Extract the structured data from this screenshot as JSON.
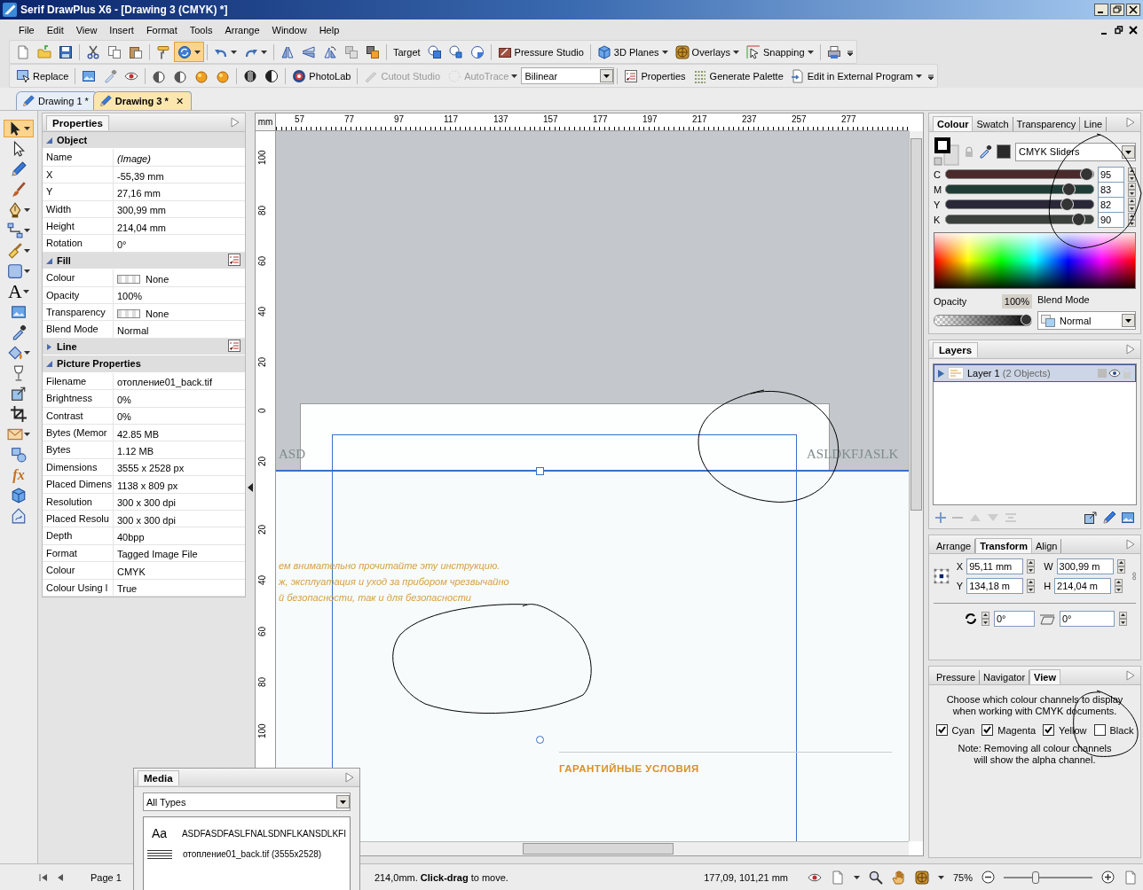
{
  "window": {
    "title": "Serif DrawPlus X6 - [Drawing 3 (CMYK) *]"
  },
  "menu": [
    "File",
    "Edit",
    "View",
    "Insert",
    "Format",
    "Tools",
    "Arrange",
    "Window",
    "Help"
  ],
  "toolbar_1": [
    [
      {
        "kind": "icon"
      },
      {
        "kind": "icon"
      },
      {
        "kind": "icon"
      }
    ],
    [
      {
        "kind": "icon"
      },
      {
        "kind": "icon"
      },
      {
        "kind": "icon"
      }
    ],
    [
      {
        "kind": "icon"
      },
      {
        "kind": "icon",
        "selected": true,
        "menu": true
      }
    ],
    [
      {
        "kind": "icon",
        "menu": true
      },
      {
        "kind": "icon",
        "menu": true
      }
    ],
    [
      {
        "kind": "icon"
      },
      {
        "kind": "icon"
      },
      {
        "kind": "icon"
      },
      {
        "kind": "icon"
      },
      {
        "kind": "icon"
      }
    ],
    [
      {
        "kind": "text",
        "label": "Target"
      },
      {
        "kind": "icon"
      },
      {
        "kind": "icon"
      },
      {
        "kind": "icon"
      }
    ],
    [
      {
        "kind": "button",
        "label": "Pressure Studio"
      }
    ],
    [
      {
        "kind": "button",
        "label": "3D Planes",
        "menu": true
      },
      {
        "kind": "button",
        "label": "Overlays",
        "menu": true
      },
      {
        "kind": "button",
        "label": "Snapping",
        "menu": true
      }
    ],
    [
      {
        "kind": "icon"
      }
    ]
  ],
  "toolbar_2": [
    [
      {
        "kind": "button",
        "label": "Replace"
      }
    ],
    [
      {
        "kind": "icon"
      },
      {
        "kind": "icon",
        "disabled": true
      },
      {
        "kind": "icon"
      }
    ],
    [
      {
        "kind": "icon"
      },
      {
        "kind": "icon"
      },
      {
        "kind": "icon"
      },
      {
        "kind": "icon"
      }
    ],
    [
      {
        "kind": "icon"
      },
      {
        "kind": "icon"
      }
    ],
    [
      {
        "kind": "button",
        "label": "PhotoLab"
      }
    ],
    [
      {
        "kind": "button",
        "label": "Cutout Studio",
        "disabled": true
      },
      {
        "kind": "button",
        "label": "AutoTrace",
        "disabled": true,
        "menu": true
      },
      {
        "kind": "dropdown",
        "value": "Bilinear"
      }
    ],
    [
      {
        "kind": "button",
        "label": "Properties"
      },
      {
        "kind": "button",
        "label": "Generate Palette"
      },
      {
        "kind": "button",
        "label": "Edit in External Program",
        "menu": true
      }
    ]
  ],
  "doc_tabs": [
    {
      "label": "Drawing 1 *",
      "selected": false
    },
    {
      "label": "Drawing 3 *",
      "selected": true,
      "close": "✕"
    }
  ],
  "toolbox": [
    {
      "selected": true,
      "menu": true
    },
    {
      "selected": false
    },
    {
      "selected": false
    },
    {
      "selected": false
    },
    {
      "selected": false,
      "menu": true
    },
    {
      "selected": false,
      "menu": true
    },
    {
      "selected": false,
      "menu": true
    },
    {
      "selected": false,
      "menu": true
    },
    {
      "glyph": "A",
      "selected": false,
      "menu": true
    },
    {
      "selected": false
    },
    {
      "selected": false
    },
    {
      "selected": false,
      "menu": true
    },
    {
      "selected": false
    },
    {
      "selected": false
    },
    {
      "selected": false
    },
    {
      "selected": false,
      "menu": true
    },
    {
      "selected": false
    },
    {
      "glyph": "fx",
      "selected": false
    },
    {
      "selected": false
    },
    {
      "selected": false
    }
  ],
  "properties": {
    "tab": "Properties",
    "sections": [
      {
        "title": "Object",
        "expanded": true,
        "rows": [
          {
            "label": "Name",
            "value": "(Image)",
            "kind": "italic"
          },
          {
            "label": "X",
            "value": "-55,39 mm"
          },
          {
            "label": "Y",
            "value": "27,16 mm"
          },
          {
            "label": "Width",
            "value": "300,99 mm"
          },
          {
            "label": "Height",
            "value": "214,04 mm"
          },
          {
            "label": "Rotation",
            "value": "0°"
          }
        ]
      },
      {
        "title": "Fill",
        "expanded": true,
        "options": true,
        "rows": [
          {
            "label": "Colour",
            "value": "None",
            "kind": "swatch"
          },
          {
            "label": "Opacity",
            "value": "100%"
          },
          {
            "label": "Transparency",
            "value": "None",
            "kind": "swatch"
          },
          {
            "label": "Blend Mode",
            "value": "Normal"
          }
        ]
      },
      {
        "title": "Line",
        "expanded": false,
        "options": true
      },
      {
        "title": "Picture Properties",
        "expanded": true,
        "rows": [
          {
            "label": "Filename",
            "value": "отопление01_back.tif"
          },
          {
            "label": "Brightness",
            "value": "0%"
          },
          {
            "label": "Contrast",
            "value": "0%"
          },
          {
            "label": "Bytes (Memor",
            "value": "42.85 MB"
          },
          {
            "label": "Bytes",
            "value": "1.12 MB"
          },
          {
            "label": "Dimensions",
            "value": "3555 x 2528 px"
          },
          {
            "label": "Placed Dimens",
            "value": "1138 x 809 px"
          },
          {
            "label": "Resolution",
            "value": "300 x 300 dpi"
          },
          {
            "label": "Placed Resolu",
            "value": "300 x 300 dpi"
          },
          {
            "label": "Depth",
            "value": "40bpp"
          },
          {
            "label": "Format",
            "value": "Tagged Image File"
          },
          {
            "label": "Colour",
            "value": "CMYK"
          },
          {
            "label": "Colour Using l",
            "value": "True"
          }
        ]
      }
    ]
  },
  "canvas": {
    "ruler_unit": "mm",
    "top_ruler": [
      "57",
      "77",
      "97",
      "117",
      "137",
      "157",
      "177",
      "197",
      "217",
      "237",
      "257",
      "277"
    ],
    "left_ruler": [
      "100",
      "80",
      "60",
      "40",
      "20",
      "0",
      "20",
      "20",
      "40",
      "60",
      "80",
      "100"
    ],
    "image_text_left": "ASD",
    "image_text_right": "ASLDKFJASLK",
    "body_lines": [
      "ем внимательно прочитайте эту инструкцию.",
      "ж, эксплуатация и уход за прибором чрезвычайно",
      "й безопасности, так и для безопасности"
    ],
    "heading": "ГАРАНТИЙНЫЕ УСЛОВИЯ"
  },
  "colour_panel": {
    "tabs": [
      {
        "label": "Colour",
        "selected": true
      },
      {
        "label": "Swatch",
        "selected": false
      },
      {
        "label": "Transparency",
        "selected": false
      },
      {
        "label": "Line",
        "selected": false
      }
    ],
    "mode": "CMYK Sliders",
    "channels": [
      {
        "name": "C",
        "level": 0.95,
        "value": "95",
        "color": "#4a2a2a"
      },
      {
        "name": "M",
        "level": 0.83,
        "value": "83",
        "color": "#1f3d36"
      },
      {
        "name": "Y",
        "level": 0.82,
        "value": "82",
        "color": "#2a2838"
      },
      {
        "name": "K",
        "level": 0.9,
        "value": "90",
        "color": "#3a403c"
      }
    ],
    "opacity_label": "Opacity",
    "opacity_value": "100%",
    "opacity": {
      "level": 1
    },
    "blend_label": "Blend Mode",
    "blend_mode": "Normal"
  },
  "layers_panel": {
    "tab": "Layers",
    "layers": [
      {
        "name": "Layer 1",
        "detail": "(2 Objects)",
        "selected": true
      }
    ]
  },
  "transform_panel": {
    "tabs": [
      {
        "label": "Arrange",
        "selected": false
      },
      {
        "label": "Transform",
        "selected": true
      },
      {
        "label": "Align",
        "selected": false
      }
    ],
    "fields": [
      {
        "label": "X",
        "value": "95,11 mm"
      },
      {
        "label": "W",
        "value": "300,99 m"
      },
      {
        "label": "Y",
        "value": "134,18 m"
      },
      {
        "label": "H",
        "value": "214,04 m"
      }
    ],
    "rotation": "0°",
    "shear": "0°"
  },
  "view_panel": {
    "tabs": [
      {
        "label": "Pressure",
        "selected": false
      },
      {
        "label": "Navigator",
        "selected": false
      },
      {
        "label": "View",
        "selected": true
      }
    ],
    "intro": "Choose which colour channels to display when working with CMYK documents.",
    "channels": [
      {
        "label": "Cyan",
        "checked": true
      },
      {
        "label": "Magenta",
        "checked": true
      },
      {
        "label": "Yellow",
        "checked": true
      },
      {
        "label": "Black",
        "checked": false
      }
    ],
    "note": "Note: Removing all colour channels will show the alpha channel."
  },
  "media_panel": {
    "tab": "Media",
    "filter": "All Types",
    "items": [
      {
        "kind": "font",
        "glyph": "Aa",
        "label": "ASDFASDFASLFNALSDNFLKANSDLKFI"
      },
      {
        "kind": "image",
        "label": "отопление01_back.tif (3555x2528)"
      }
    ]
  },
  "status_bar": {
    "page": "Page 1",
    "hint": "214,0mm. **Click-drag** to move.",
    "coords": "177,09, 101,21 mm",
    "zoom": "75%",
    "zoom_slider": {
      "level": 0.35
    }
  }
}
